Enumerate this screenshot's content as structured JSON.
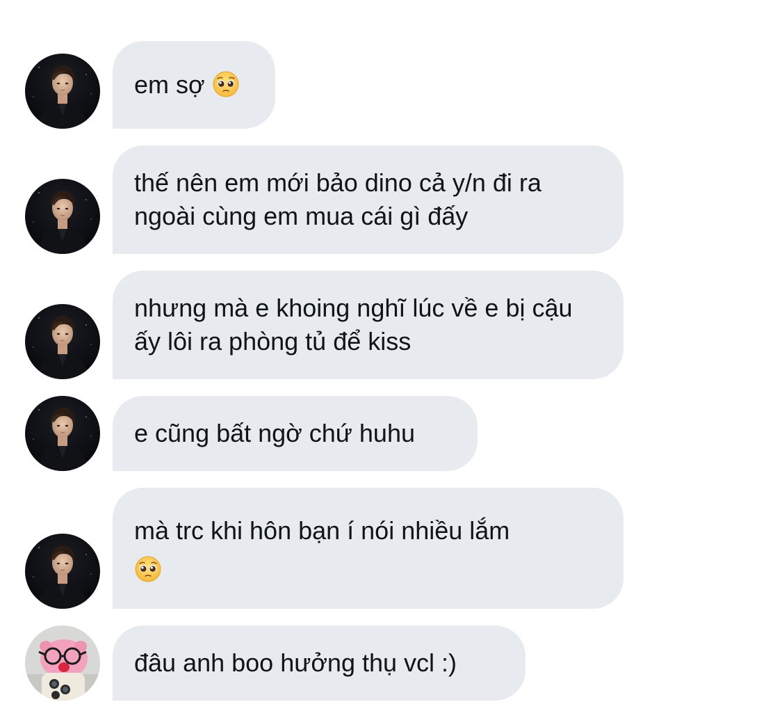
{
  "conversation": {
    "messages": [
      {
        "sender": "avatar-guy",
        "text": "em sợ",
        "emoji": "pleading-face-emoji"
      },
      {
        "sender": "avatar-guy",
        "text": "thế nên em mới bảo dino cả y/n đi ra ngoài cùng em mua cái gì đấy"
      },
      {
        "sender": "avatar-guy",
        "text": "nhưng mà e khoing nghĩ lúc về e bị cậu ấy lôi ra phòng tủ để kiss"
      },
      {
        "sender": "avatar-guy",
        "text": "e cũng bất ngờ chứ huhu"
      },
      {
        "sender": "avatar-guy",
        "text": "mà trc khi hôn bạn í nói nhiều lắm",
        "emoji": "pleading-face-emoji"
      },
      {
        "sender": "avatar-pink-plush",
        "text": "đâu anh boo hưởng thụ vcl :)"
      }
    ]
  },
  "colors": {
    "bubble_bg": "#e7ebf0",
    "text": "#0f1419",
    "background": "#ffffff"
  }
}
